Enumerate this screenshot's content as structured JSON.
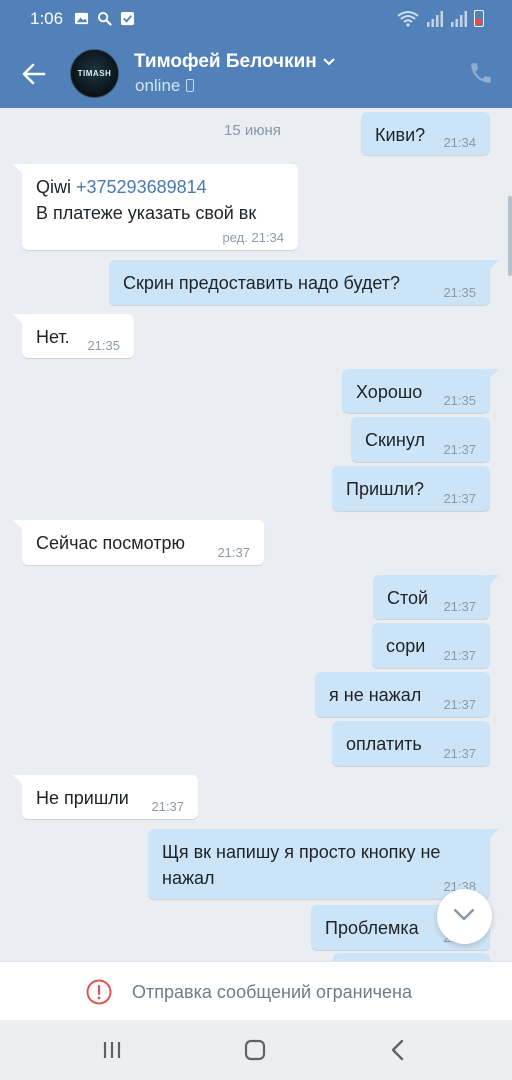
{
  "status_bar": {
    "time": "1:06",
    "icons": [
      "gallery-icon",
      "search-icon",
      "check-square-icon",
      "wifi-icon",
      "signal-icon",
      "battery-icon"
    ],
    "battery_color": "#e54b4b"
  },
  "header": {
    "contact_name": "Тимофей Белочкин",
    "status": "online",
    "avatar_text": "TIMASH",
    "accent": "#5181b8"
  },
  "chat": {
    "date": "15 июня",
    "messages": [
      {
        "dir": "out",
        "text": "Киви?",
        "time": "21:34"
      },
      {
        "dir": "in",
        "line1_prefix": "Qiwi ",
        "line1_link": "+375293689814",
        "line2": "В платеже указать свой вк",
        "time": "ред. 21:34"
      },
      {
        "dir": "out",
        "text": "Скрин предоставить надо будет?",
        "time": "21:35"
      },
      {
        "dir": "in",
        "text": "Нет.",
        "time": "21:35"
      },
      {
        "dir": "out",
        "text": "Хорошо",
        "time": "21:35"
      },
      {
        "dir": "out",
        "text": "Скинул",
        "time": "21:37"
      },
      {
        "dir": "out",
        "text": "Пришли?",
        "time": "21:37"
      },
      {
        "dir": "in",
        "text": "Сейчас посмотрю",
        "time": "21:37"
      },
      {
        "dir": "out",
        "text": "Стой",
        "time": "21:37"
      },
      {
        "dir": "out",
        "text": "сори",
        "time": "21:37"
      },
      {
        "dir": "out",
        "text": "я не нажал",
        "time": "21:37"
      },
      {
        "dir": "out",
        "text": "оплатить",
        "time": "21:37"
      },
      {
        "dir": "in",
        "text": "Не пришли",
        "time": "21:37"
      },
      {
        "dir": "out",
        "line1": "Щя вк напишу я просто кнопку не",
        "line2": "нажал",
        "time": "21:38"
      },
      {
        "dir": "out",
        "text": "Проблемка",
        "time": "21:38"
      }
    ]
  },
  "footer": {
    "restricted_text": "Отправка сообщений ограничена",
    "warn_color": "#e0554f"
  },
  "nav": {
    "buttons": [
      "recent-apps-icon",
      "home-icon",
      "back-icon"
    ]
  }
}
